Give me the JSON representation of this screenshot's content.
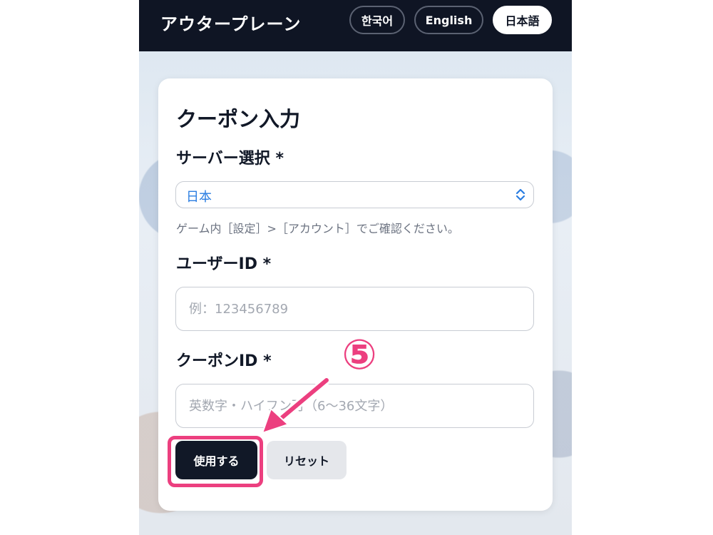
{
  "header": {
    "brand": "アウタープレーン",
    "languages": [
      {
        "label": "한국어",
        "active": false
      },
      {
        "label": "English",
        "active": false
      },
      {
        "label": "日本語",
        "active": true
      }
    ]
  },
  "form": {
    "title": "クーポン入力",
    "server_label": "サーバー選択 *",
    "server_value": "日本",
    "server_help": "ゲーム内［設定］>［アカウント］でご確認ください。",
    "user_id_label": "ユーザーID *",
    "user_id_placeholder": "例：123456789",
    "user_id_value": "",
    "coupon_id_label": "クーポンID *",
    "coupon_id_placeholder": "英数字・ハイフン可（6〜36文字）",
    "coupon_id_value": "",
    "submit_label": "使用する",
    "reset_label": "リセット"
  },
  "annotation": {
    "step_marker": "⑤",
    "color": "#ec3f7f"
  },
  "icons": {
    "select_chevron": "chevron-up-down-icon",
    "arrow": "pointer-arrow-icon"
  }
}
